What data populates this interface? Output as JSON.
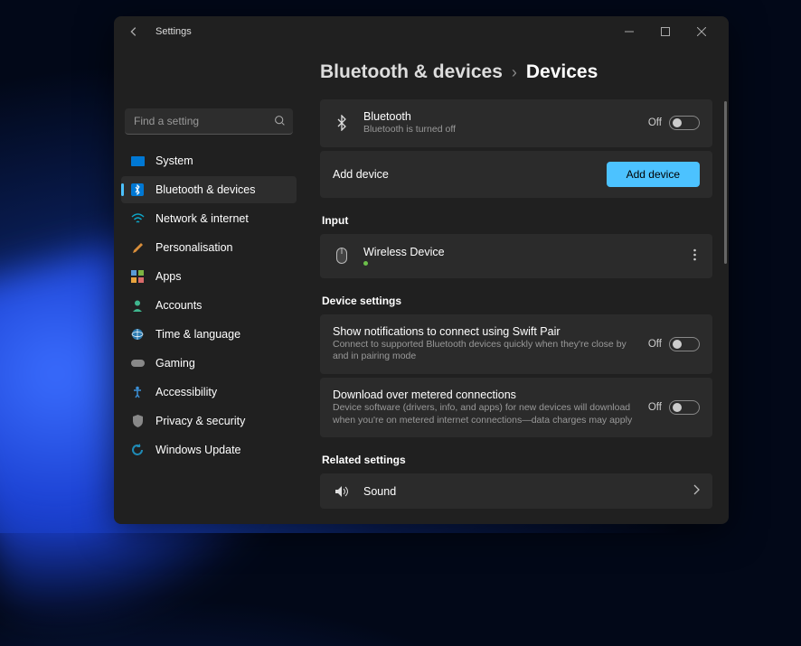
{
  "app_title": "Settings",
  "search_placeholder": "Find a setting",
  "sidebar": {
    "items": [
      {
        "label": "System",
        "icon": "system"
      },
      {
        "label": "Bluetooth & devices",
        "icon": "bluetooth",
        "active": true
      },
      {
        "label": "Network & internet",
        "icon": "wifi"
      },
      {
        "label": "Personalisation",
        "icon": "brush"
      },
      {
        "label": "Apps",
        "icon": "apps"
      },
      {
        "label": "Accounts",
        "icon": "person"
      },
      {
        "label": "Time & language",
        "icon": "globe"
      },
      {
        "label": "Gaming",
        "icon": "gaming"
      },
      {
        "label": "Accessibility",
        "icon": "accessibility"
      },
      {
        "label": "Privacy & security",
        "icon": "shield"
      },
      {
        "label": "Windows Update",
        "icon": "update"
      }
    ]
  },
  "breadcrumb": {
    "parent": "Bluetooth & devices",
    "current": "Devices"
  },
  "bluetooth_card": {
    "title": "Bluetooth",
    "sub": "Bluetooth is turned off",
    "state_label": "Off"
  },
  "add_device": {
    "label": "Add device",
    "button": "Add device"
  },
  "sections": {
    "input": "Input",
    "device_settings": "Device settings",
    "related": "Related settings"
  },
  "input_device": {
    "name": "Wireless Device"
  },
  "swift_pair": {
    "title": "Show notifications to connect using Swift Pair",
    "sub": "Connect to supported Bluetooth devices quickly when they're close by and in pairing mode",
    "state_label": "Off"
  },
  "metered": {
    "title": "Download over metered connections",
    "sub": "Device software (drivers, info, and apps) for new devices will download when you're on metered internet connections—data charges may apply",
    "state_label": "Off"
  },
  "sound": {
    "title": "Sound"
  }
}
